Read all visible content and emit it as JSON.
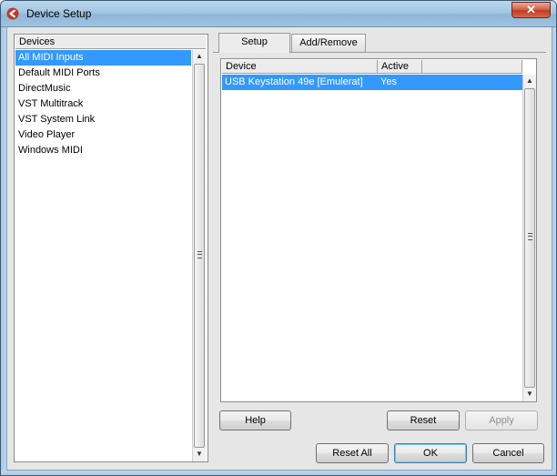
{
  "window": {
    "title": "Device Setup",
    "close_label": "✕"
  },
  "devices": {
    "header": "Devices",
    "items": [
      "All MIDI Inputs",
      "Default MIDI Ports",
      "DirectMusic",
      "VST Multitrack",
      "VST System Link",
      "Video Player",
      "Windows MIDI"
    ],
    "selected": "All MIDI Inputs"
  },
  "tabs": [
    {
      "label": "Setup",
      "active": true
    },
    {
      "label": "Add/Remove",
      "active": false
    }
  ],
  "table": {
    "columns": [
      "Device",
      "Active"
    ],
    "rows": [
      {
        "device": "USB Keystation 49e [Emulerat]",
        "active": "Yes"
      }
    ]
  },
  "buttons": {
    "help": "Help",
    "reset": "Reset",
    "apply": "Apply",
    "reset_all": "Reset All",
    "ok": "OK",
    "cancel": "Cancel"
  },
  "colors": {
    "selection": "#3399ff",
    "titlebar": "#a3c6e3",
    "close": "#c2391e"
  },
  "icons": {
    "app": "cubase-logo-icon",
    "scroll_up": "arrow-up-icon",
    "scroll_down": "arrow-down-icon",
    "grip": "scroll-grip-icon"
  }
}
